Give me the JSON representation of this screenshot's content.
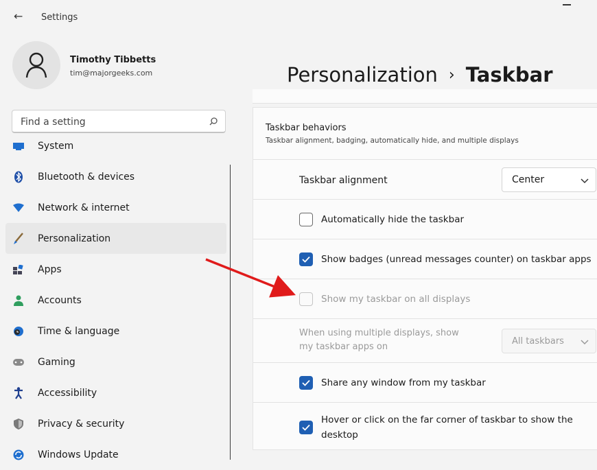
{
  "window": {
    "title": "Settings",
    "back_glyph": "←"
  },
  "profile": {
    "name": "Timothy Tibbetts",
    "email": "tim@majorgeeks.com"
  },
  "search": {
    "placeholder": "Find a setting"
  },
  "sidebar": {
    "items": [
      {
        "label": "System",
        "icon": "monitor-icon",
        "color": "#1f6fcf"
      },
      {
        "label": "Bluetooth & devices",
        "icon": "bluetooth-icon",
        "color": "#1f6fcf"
      },
      {
        "label": "Network & internet",
        "icon": "wifi-icon",
        "color": "#1f6fcf"
      },
      {
        "label": "Personalization",
        "icon": "brush-icon",
        "color": "#8a6a3a",
        "active": true
      },
      {
        "label": "Apps",
        "icon": "apps-icon",
        "color": "#445"
      },
      {
        "label": "Accounts",
        "icon": "person-icon",
        "color": "#2f9e5e"
      },
      {
        "label": "Time & language",
        "icon": "globe-clock-icon",
        "color": "#1f6fcf"
      },
      {
        "label": "Gaming",
        "icon": "gamepad-icon",
        "color": "#777"
      },
      {
        "label": "Accessibility",
        "icon": "accessibility-icon",
        "color": "#1f3f8f"
      },
      {
        "label": "Privacy & security",
        "icon": "shield-icon",
        "color": "#777"
      },
      {
        "label": "Windows Update",
        "icon": "update-icon",
        "color": "#1f6fcf"
      }
    ]
  },
  "header": {
    "parent": "Personalization",
    "separator": "›",
    "current": "Taskbar"
  },
  "section": {
    "title": "Taskbar behaviors",
    "subtitle": "Taskbar alignment, badging, automatically hide, and multiple displays"
  },
  "settings": {
    "alignment_label": "Taskbar alignment",
    "alignment_value": "Center",
    "auto_hide_label": "Automatically hide the taskbar",
    "badges_label": "Show badges (unread messages counter) on taskbar apps",
    "all_displays_label": "Show my taskbar on all displays",
    "multi_display_label_line1": "When using multiple displays, show",
    "multi_display_label_line2": "my taskbar apps on",
    "multi_display_value": "All taskbars",
    "share_window_label": "Share any window from my taskbar",
    "hover_corner_label_line1": "Hover or click on the far corner of taskbar to show the",
    "hover_corner_label_line2": "desktop"
  },
  "colors": {
    "accent": "#1f5fb3",
    "arrow": "#e01b1b"
  }
}
